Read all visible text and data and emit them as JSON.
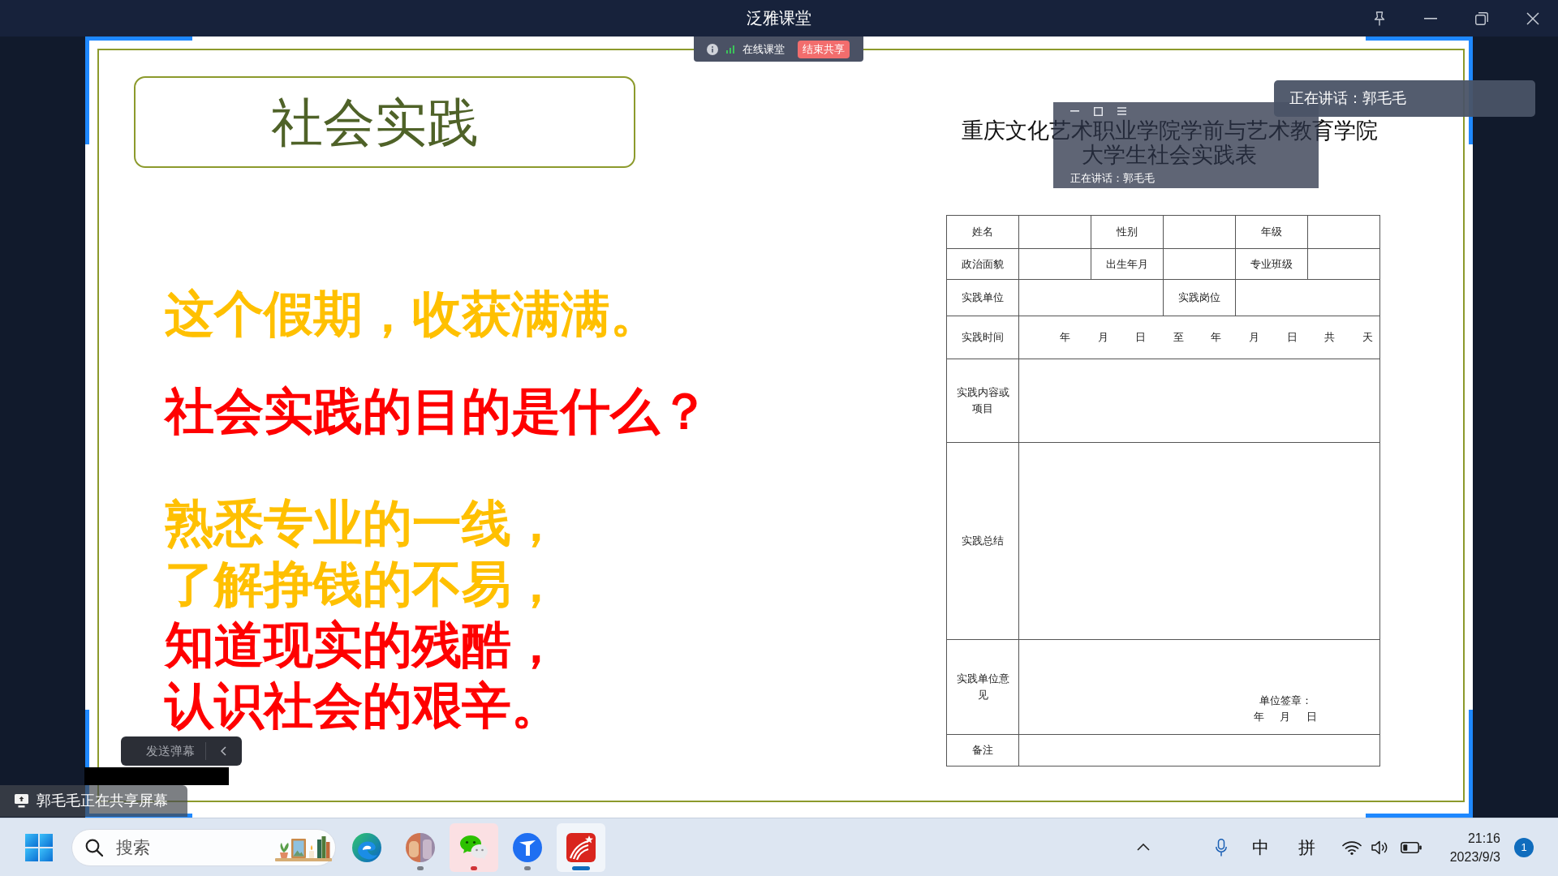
{
  "window": {
    "title": "泛雅课堂"
  },
  "share_toolbar": {
    "label": "在线课堂",
    "end_button": "结束共享"
  },
  "slide": {
    "title": "社会实践",
    "statements": [
      {
        "text": "这个假期，收获满满。",
        "color": "#ffc000"
      },
      {
        "text": "社会实践的目的是什么？",
        "color": "#ff0000"
      }
    ],
    "answers": [
      {
        "text": "熟悉专业的一线，",
        "color": "#ffc000"
      },
      {
        "text": "了解挣钱的不易，",
        "color": "#ffc000"
      },
      {
        "text": "知道现实的残酷，",
        "color": "#ff0000"
      },
      {
        "text": "认识社会的艰辛。",
        "color": "#ff0000"
      }
    ],
    "form": {
      "heading": [
        "重庆文化艺术职业学院学前与艺术教育学院",
        "大学生社会实践表"
      ],
      "rows": [
        [
          "姓名",
          "",
          "性别",
          "",
          "年级",
          ""
        ],
        [
          "政治面貌",
          "",
          "出生年月",
          "",
          "专业班级",
          ""
        ],
        [
          "实践单位",
          {
            "text": "",
            "colspan": 2
          },
          "实践岗位",
          {
            "text": "",
            "colspan": 2
          }
        ],
        [
          "实践时间",
          {
            "text": "年 月 日 至 年 月 日 共 天",
            "colspan": 5
          }
        ],
        [
          "实践内容或项目",
          {
            "text": "",
            "colspan": 5
          }
        ],
        [
          "实践总结",
          {
            "text": "",
            "colspan": 5
          }
        ],
        [
          "实践单位意见",
          {
            "lines": [
              "单位签章：",
              "年 月 日"
            ],
            "colspan": 5
          }
        ],
        [
          "备注",
          {
            "text": "",
            "colspan": 5
          }
        ]
      ]
    }
  },
  "video_window": {
    "speaker": "正在讲话：郭毛毛"
  },
  "speaker_banner": {
    "text": "正在讲话：郭毛毛"
  },
  "danmaku_bar": {
    "send_button": "发送弹幕"
  },
  "share_notice": {
    "text": "郭毛毛正在共享屏幕"
  },
  "taskbar": {
    "search": {
      "placeholder": "搜索"
    },
    "apps": [
      {
        "kind": "browser",
        "running": false,
        "attention": false,
        "selected": false
      },
      {
        "kind": "photo",
        "running": true,
        "attention": false,
        "selected": false
      },
      {
        "kind": "chat",
        "running": true,
        "attention": true,
        "selected": false
      },
      {
        "kind": "navigator",
        "running": true,
        "attention": false,
        "selected": false
      },
      {
        "kind": "reader",
        "running": true,
        "attention": false,
        "selected": true
      }
    ],
    "tray": {
      "ime_mode": "中",
      "ime_name": "拼",
      "time": "21:16",
      "date": "2023/9/3",
      "notification_count": "1"
    }
  }
}
